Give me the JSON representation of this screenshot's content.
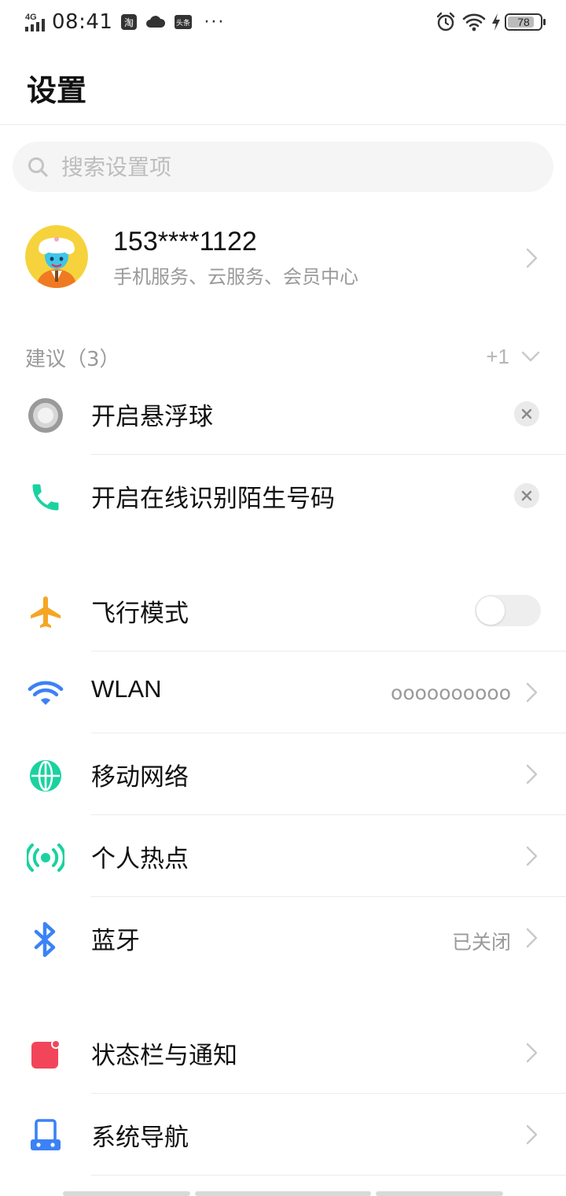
{
  "status_bar": {
    "network": "4G",
    "time": "08:41",
    "app_icons": [
      "taobao-icon",
      "cloud-icon",
      "toutiao-icon"
    ],
    "more": "···",
    "battery": "78"
  },
  "header": {
    "title": "设置"
  },
  "search": {
    "placeholder": "搜索设置项"
  },
  "account": {
    "name": "153****1122",
    "subtitle": "手机服务、云服务、会员中心"
  },
  "suggestions": {
    "title": "建议（3）",
    "more": "+1",
    "items": [
      {
        "label": "开启悬浮球",
        "icon": "floating-ball-icon"
      },
      {
        "label": "开启在线识别陌生号码",
        "icon": "phone-icon"
      }
    ]
  },
  "network_settings": [
    {
      "label": "飞行模式",
      "icon": "airplane-icon",
      "toggle": false
    },
    {
      "label": "WLAN",
      "value": "oooooooooo",
      "icon": "wifi-icon"
    },
    {
      "label": "移动网络",
      "icon": "globe-icon"
    },
    {
      "label": "个人热点",
      "icon": "hotspot-icon"
    },
    {
      "label": "蓝牙",
      "value": "已关闭",
      "icon": "bluetooth-icon"
    }
  ],
  "system_settings": [
    {
      "label": "状态栏与通知",
      "icon": "notification-icon"
    },
    {
      "label": "系统导航",
      "icon": "navigation-icon"
    }
  ],
  "colors": {
    "airplane": "#f5a623",
    "wifi": "#3b82f6",
    "globe": "#19d2a0",
    "hotspot": "#19d2a0",
    "bluetooth": "#3b82f6",
    "notification": "#f2455a",
    "navigation": "#3b82f6",
    "phone": "#19d2a0"
  }
}
